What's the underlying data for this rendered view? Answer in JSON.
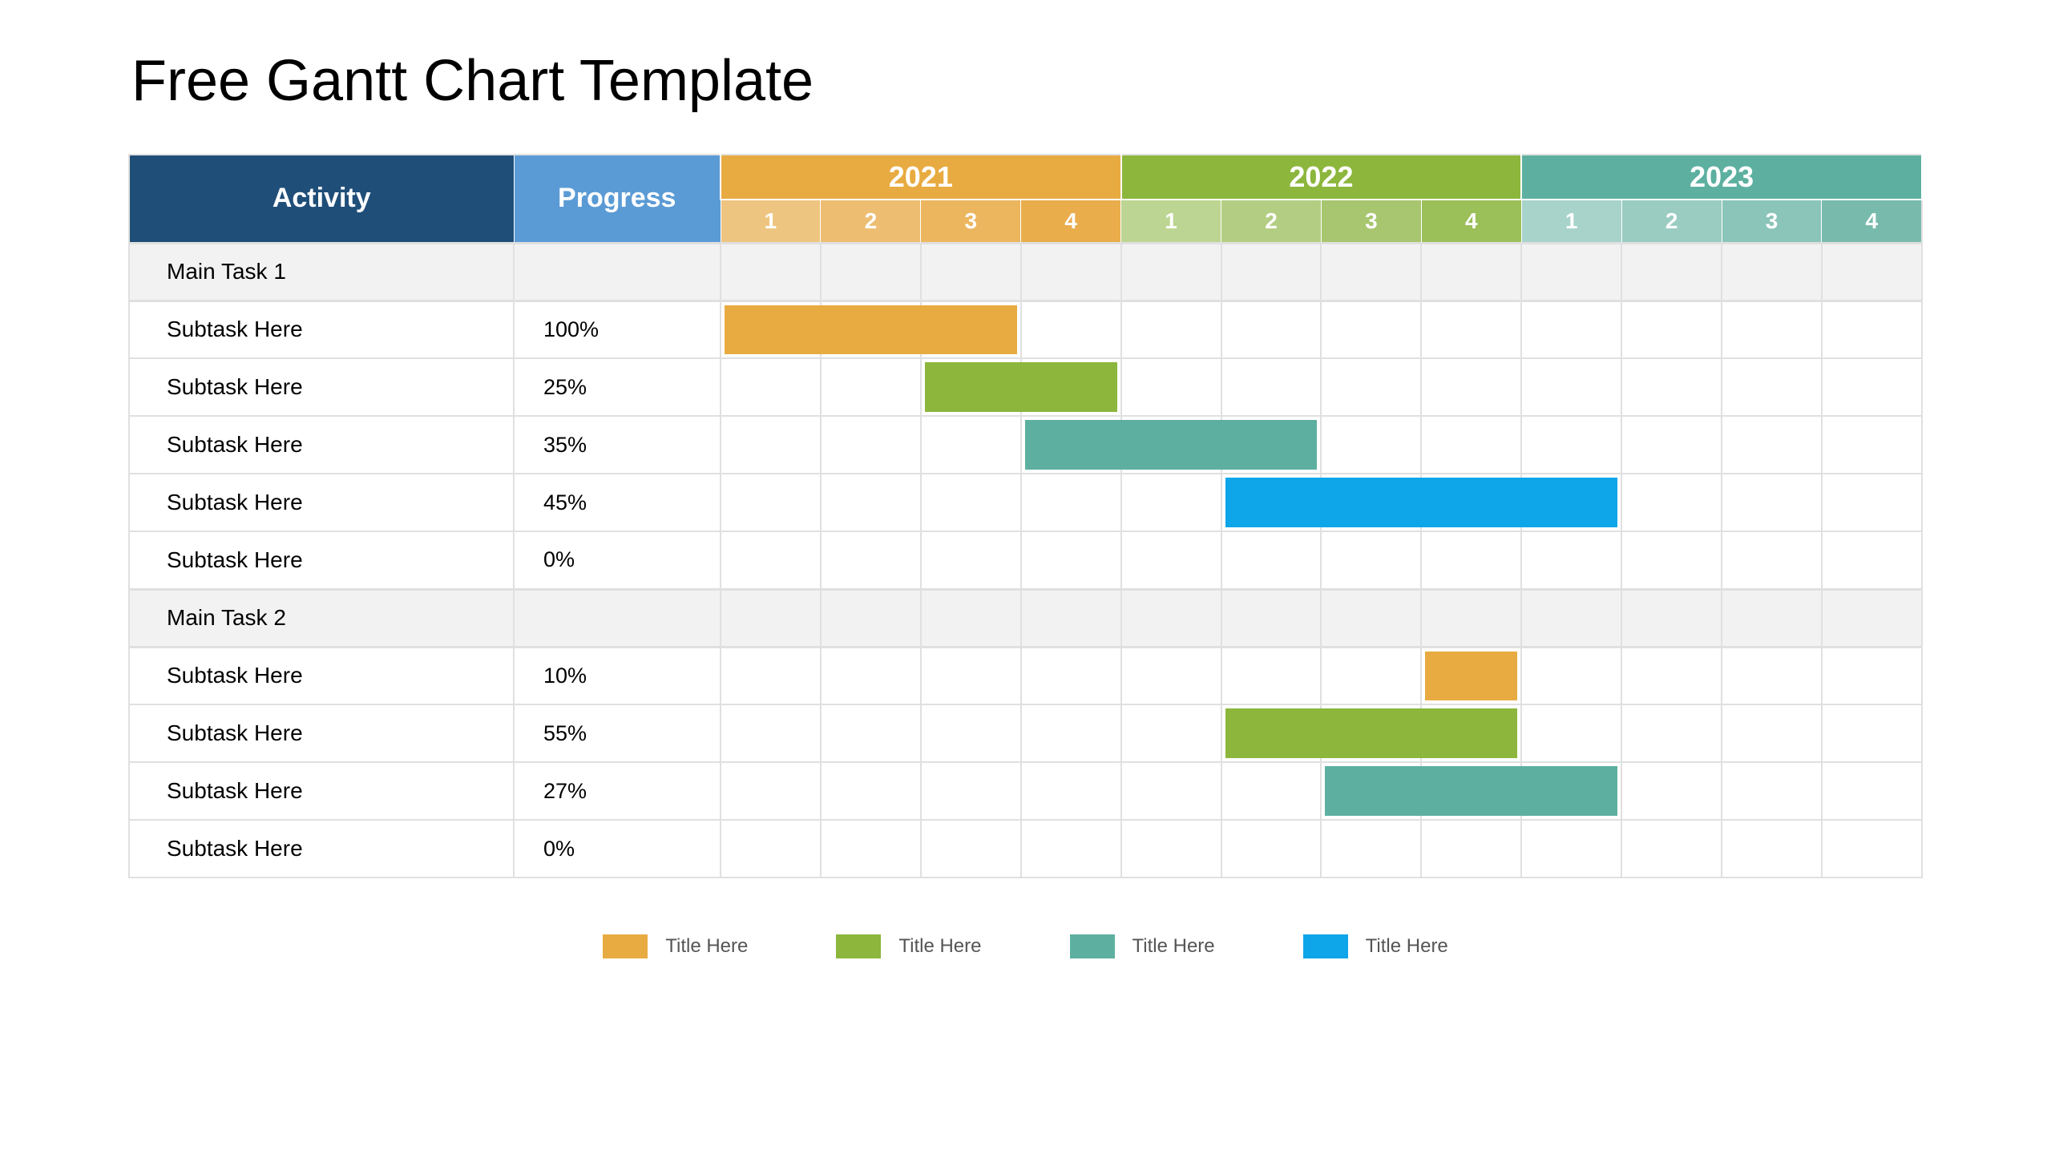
{
  "title": "Free Gantt Chart Template",
  "headers": {
    "activity": "Activity",
    "progress": "Progress"
  },
  "chart_data": {
    "type": "gantt",
    "years": [
      {
        "label": "2021",
        "color": "#e8ab41",
        "quarters": [
          "1",
          "2",
          "3",
          "4"
        ],
        "qColors": [
          "#eec580",
          "#edbe72",
          "#ebb65e",
          "#e9ad4c"
        ]
      },
      {
        "label": "2022",
        "color": "#8cb63c",
        "quarters": [
          "1",
          "2",
          "3",
          "4"
        ],
        "qColors": [
          "#bdd592",
          "#b3ce82",
          "#a8c66f",
          "#9bbf59"
        ]
      },
      {
        "label": "2023",
        "color": "#5db0a0",
        "quarters": [
          "1",
          "2",
          "3",
          "4"
        ],
        "qColors": [
          "#a8d3cb",
          "#9accc2",
          "#8bc4b8",
          "#78bbad"
        ]
      }
    ],
    "rows": [
      {
        "type": "main",
        "label": "Main Task 1",
        "progress": ""
      },
      {
        "type": "sub",
        "label": "Subtask Here",
        "progress": "100%",
        "bar": {
          "startQ": 0,
          "endQ": 2,
          "color": "#e8ab41"
        }
      },
      {
        "type": "sub",
        "label": "Subtask Here",
        "progress": "25%",
        "bar": {
          "startQ": 2,
          "endQ": 3,
          "color": "#8cb63c"
        }
      },
      {
        "type": "sub",
        "label": "Subtask Here",
        "progress": "35%",
        "bar": {
          "startQ": 3,
          "endQ": 5,
          "color": "#5db0a0"
        }
      },
      {
        "type": "sub",
        "label": "Subtask Here",
        "progress": "45%",
        "bar": {
          "startQ": 5,
          "endQ": 8,
          "color": "#0ea5e9"
        }
      },
      {
        "type": "sub",
        "label": "Subtask Here",
        "progress": "0%"
      },
      {
        "type": "main",
        "label": "Main Task 2",
        "progress": ""
      },
      {
        "type": "sub",
        "label": "Subtask Here",
        "progress": "10%",
        "bar": {
          "startQ": 7,
          "endQ": 7,
          "color": "#e8ab41"
        }
      },
      {
        "type": "sub",
        "label": "Subtask Here",
        "progress": "55%",
        "bar": {
          "startQ": 5,
          "endQ": 7,
          "color": "#8cb63c"
        }
      },
      {
        "type": "sub",
        "label": "Subtask Here",
        "progress": "27%",
        "bar": {
          "startQ": 6,
          "endQ": 8,
          "color": "#5db0a0"
        }
      },
      {
        "type": "sub",
        "label": "Subtask Here",
        "progress": "0%"
      }
    ],
    "legend": [
      {
        "color": "#e8ab41",
        "label": "Title Here"
      },
      {
        "color": "#8cb63c",
        "label": "Title Here"
      },
      {
        "color": "#5db0a0",
        "label": "Title Here"
      },
      {
        "color": "#0ea5e9",
        "label": "Title Here"
      }
    ]
  }
}
